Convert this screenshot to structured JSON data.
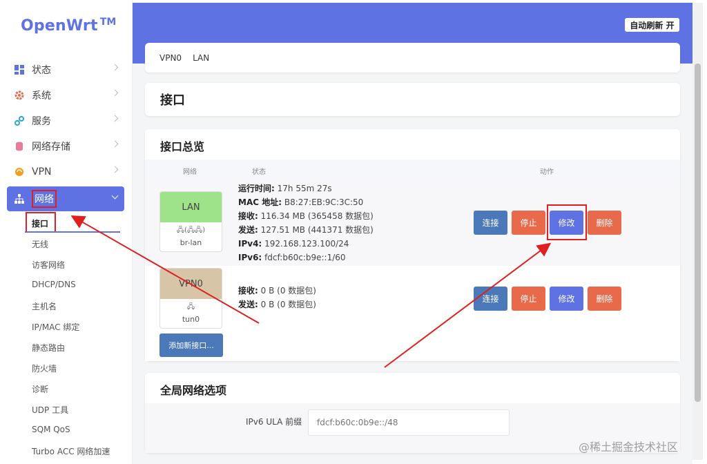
{
  "brand": {
    "name": "OpenWrt",
    "tm": "TM"
  },
  "sidebar": {
    "items": [
      {
        "label": "状态",
        "icon": "dashboard-icon"
      },
      {
        "label": "系统",
        "icon": "gear-icon"
      },
      {
        "label": "服务",
        "icon": "services-icon"
      },
      {
        "label": "网络存储",
        "icon": "database-icon"
      },
      {
        "label": "VPN",
        "icon": "vpn-icon"
      },
      {
        "label": "网络",
        "icon": "network-icon"
      }
    ],
    "network_submenu": [
      "接口",
      "无线",
      "访客网络",
      "DHCP/DNS",
      "主机名",
      "IP/MAC 绑定",
      "静态路由",
      "防火墙",
      "诊断",
      "UDP 工具",
      "SQM QoS",
      "Turbo ACC 网络加速"
    ]
  },
  "header": {
    "auto_refresh": "自动刷新 开"
  },
  "tabs": [
    "VPN0",
    "LAN"
  ],
  "page_title": "接口",
  "overview": {
    "title": "接口总览",
    "columns": [
      "网络",
      "状态",
      "动作"
    ],
    "interfaces": [
      {
        "name": "LAN",
        "device": "br-lan",
        "icons": "🖧(🖧🖧)",
        "color": "#9ee38a",
        "status": [
          {
            "k": "运行时间:",
            "v": "17h 55m 27s"
          },
          {
            "k": "MAC 地址:",
            "v": "B8:27:EB:9C:3C:50"
          },
          {
            "k": "接收:",
            "v": "116.34 MB (365458 数据包)"
          },
          {
            "k": "发送:",
            "v": "127.51 MB (441371 数据包)"
          },
          {
            "k": "IPv4:",
            "v": "192.168.123.100/24"
          },
          {
            "k": "IPv6:",
            "v": "fdcf:b60c:b9e::1/60"
          }
        ]
      },
      {
        "name": "VPN0",
        "device": "tun0",
        "icons": "🖧",
        "color": "#d8c4a6",
        "status": [
          {
            "k": "接收:",
            "v": "0 B (0 数据包)"
          },
          {
            "k": "发送:",
            "v": "0 B (0 数据包)"
          }
        ]
      }
    ],
    "actions": {
      "connect": "连接",
      "stop": "停止",
      "edit": "修改",
      "delete": "删除"
    },
    "add_button": "添加新接口..."
  },
  "global": {
    "title": "全局网络选项",
    "ula_label": "IPv6 ULA 前缀",
    "ula_value": "fdcf:b60c:0b9e::/48"
  },
  "watermark": "@稀土掘金技术社区",
  "colors": {
    "accent": "#5e72e4",
    "connect": "#4a78b8",
    "danger": "#e86a4a",
    "highlight": "#e02020"
  }
}
